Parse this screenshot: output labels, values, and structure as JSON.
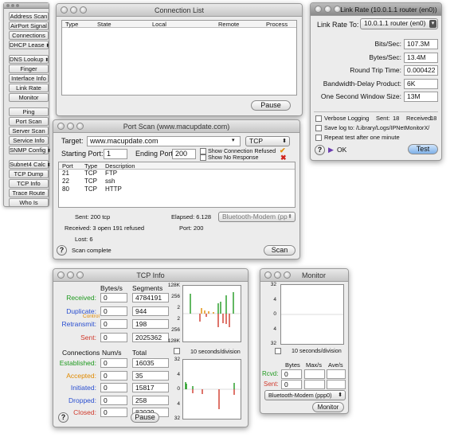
{
  "toolbar": {
    "items": [
      {
        "label": "Address Scan",
        "dropdown": false
      },
      {
        "label": "AirPort Signal",
        "dropdown": false
      },
      {
        "label": "Connections",
        "dropdown": false
      },
      {
        "label": "DHCP Lease",
        "dropdown": true
      },
      {
        "label": "DNS Lookup",
        "dropdown": true
      },
      {
        "label": "Finger",
        "dropdown": false
      },
      {
        "label": "Interface Info",
        "dropdown": false
      },
      {
        "label": "Link Rate",
        "dropdown": false
      },
      {
        "label": "Monitor",
        "dropdown": false
      },
      {
        "label": "Ping",
        "dropdown": false
      },
      {
        "label": "Port Scan",
        "dropdown": false
      },
      {
        "label": "Server Scan",
        "dropdown": false
      },
      {
        "label": "Service Info",
        "dropdown": false
      },
      {
        "label": "SNMP Config",
        "dropdown": true
      },
      {
        "label": "Subnet4 Calc",
        "dropdown": true
      },
      {
        "label": "TCP Dump",
        "dropdown": false
      },
      {
        "label": "TCP Info",
        "dropdown": false
      },
      {
        "label": "Trace Route",
        "dropdown": false
      },
      {
        "label": "Who Is",
        "dropdown": false
      }
    ]
  },
  "connection_list": {
    "title": "Connection List",
    "columns": [
      "Type",
      "State",
      "Local",
      "Remote",
      "Process"
    ],
    "pause": "Pause"
  },
  "link_rate": {
    "title": "Link Rate (10.0.1.1 router (en0))",
    "link_rate_to_label": "Link Rate To:",
    "link_rate_to_value": "10.0.1.1 router (en0)",
    "rows": [
      {
        "label": "Bits/Sec:",
        "value": "107.3M"
      },
      {
        "label": "Bytes/Sec:",
        "value": "13.4M"
      },
      {
        "label": "Round Trip Time:",
        "value": "0.000422"
      },
      {
        "label": "Bandwidth-Delay Product:",
        "value": "6K"
      },
      {
        "label": "One Second Window Size:",
        "value": "13M"
      }
    ],
    "verbose_logging": "Verbose Logging",
    "sent_label": "Sent:",
    "sent_value": "18",
    "received_label": "Received:",
    "received_value": "18",
    "save_log": "Save log to: /Library/Logs/IPNetMonitorX/",
    "repeat": "Repeat test after one minute",
    "ok": "OK",
    "test": "Test"
  },
  "port_scan": {
    "title": "Port Scan (www.macupdate.com)",
    "target_label": "Target:",
    "target_value": "www.macupdate.com",
    "protocol": "TCP",
    "starting_port_label": "Starting Port:",
    "starting_port_value": "1",
    "ending_port_label": "Ending Port:",
    "ending_port_value": "200",
    "show_refused": "Show Connection Refused",
    "show_no_response": "Show No Response",
    "columns": [
      "Port",
      "Type",
      "Description"
    ],
    "rows": [
      {
        "port": "21",
        "type": "TCP",
        "desc": "FTP"
      },
      {
        "port": "22",
        "type": "TCP",
        "desc": "ssh"
      },
      {
        "port": "80",
        "type": "TCP",
        "desc": "HTTP"
      }
    ],
    "sent": "Sent:  200 tcp",
    "elapsed": "Elapsed:  6.128",
    "interface": "Bluetooth-Modem (pp",
    "received": "Received:  3 open 191 refused",
    "port": "Port:  200",
    "lost": "Lost:  6",
    "status": "Scan complete",
    "scan": "Scan"
  },
  "tcp_info": {
    "title": "TCP Info",
    "col1": "Bytes/s",
    "col2": "Segments",
    "received": {
      "label": "Received:",
      "bytes": "0",
      "segments": "4784191",
      "color": "#1f9a1f"
    },
    "duplicate": {
      "label": "Duplicate:",
      "bytes": "0",
      "segments": "944",
      "color": "#2a4fd0"
    },
    "control": "Control",
    "retransmit": {
      "label": "Retransmit:",
      "bytes": "0",
      "segments": "198",
      "color": "#2a4fd0"
    },
    "sent": {
      "label": "Sent:",
      "bytes": "0",
      "segments": "2025362",
      "color": "#d0392b"
    },
    "conn_headers": [
      "Connections",
      "Num/s",
      "Total"
    ],
    "conn_rows": [
      {
        "label": "Established:",
        "num": "0",
        "total": "16035",
        "color": "#1f9a1f"
      },
      {
        "label": "Accepted:",
        "num": "0",
        "total": "35",
        "color": "#e08a00"
      },
      {
        "label": "Initiated:",
        "num": "0",
        "total": "15817",
        "color": "#2a4fd0"
      },
      {
        "label": "Dropped:",
        "num": "0",
        "total": "258",
        "color": "#2a4fd0"
      },
      {
        "label": "Closed:",
        "num": "0",
        "total": "82029",
        "color": "#d0392b"
      }
    ],
    "graph1_ticks": [
      "128K",
      "256",
      "2",
      "2",
      "256",
      "128K"
    ],
    "graph2_ticks": [
      "32",
      "4",
      "0",
      "4",
      "32"
    ],
    "division": "10 seconds/division",
    "pause": "Pause"
  },
  "monitor": {
    "title": "Monitor",
    "ticks": [
      "32",
      "4",
      "0",
      "4",
      "32"
    ],
    "division": "10 seconds/division",
    "headers": [
      "Bytes",
      "Max/s",
      "Ave/s"
    ],
    "rcvd": {
      "label": "Rcvd:",
      "value": "0",
      "color": "#1f9a1f"
    },
    "sent": {
      "label": "Sent:",
      "value": "0",
      "color": "#d0392b"
    },
    "interface": "Bluetooth-Modem (ppp0)",
    "monitor_btn": "Monitor"
  }
}
